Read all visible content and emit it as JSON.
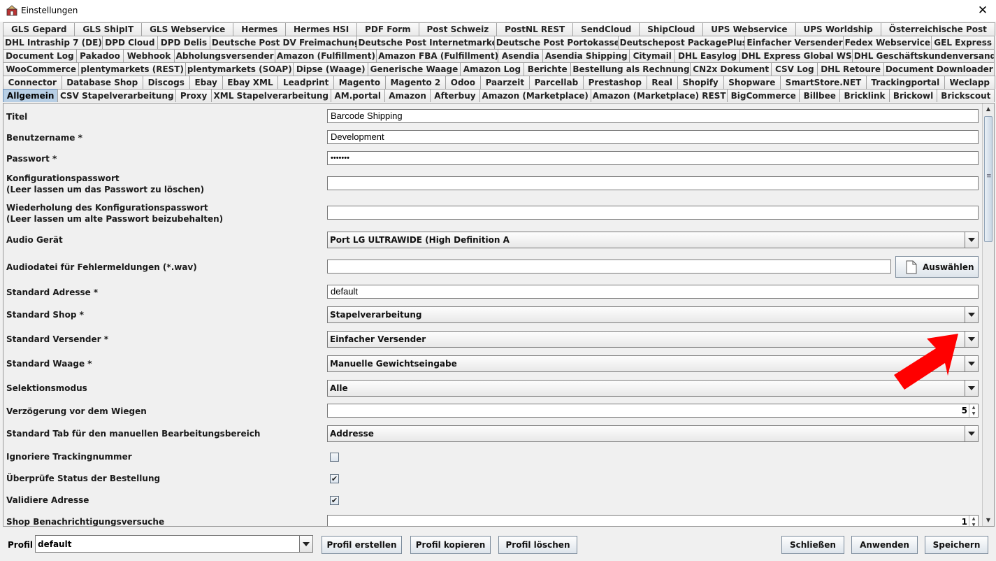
{
  "window": {
    "title": "Einstellungen",
    "close_glyph": "✕",
    "icon": "app-icon"
  },
  "tabs": {
    "row1": [
      "GLS Gepard",
      "GLS ShipIT",
      "GLS Webservice",
      "Hermes",
      "Hermes HSI",
      "PDF Form",
      "Post Schweiz",
      "PostNL REST",
      "SendCloud",
      "ShipCloud",
      "UPS Webservice",
      "UPS Worldship",
      "Österreichische Post"
    ],
    "row2": [
      "DHL Intraship 7 (DE)",
      "DPD Cloud",
      "DPD Delis",
      "Deutsche Post DV Freimachung",
      "Deutsche Post Internetmarke",
      "Deutsche Post Portokasse",
      "Deutschepost PackagePlus",
      "Einfacher Versender",
      "Fedex Webservice",
      "GEL Express"
    ],
    "row3": [
      "Document Log",
      "Pakadoo",
      "Webhook",
      "Abholungsversender",
      "Amazon (Fulfillment)",
      "Amazon FBA (Fulfillment)",
      "Asendia",
      "Asendia Shipping",
      "Citymail",
      "DHL Easylog",
      "DHL Express Global WS",
      "DHL Geschäftskundenversand"
    ],
    "row4": [
      "WooCommerce",
      "plentymarkets (REST)",
      "plentymarkets (SOAP)",
      "Dipse (Waage)",
      "Generische Waage",
      "Amazon Log",
      "Berichte",
      "Bestellung als Rechnung",
      "CN2x Dokument",
      "CSV Log",
      "DHL Retoure",
      "Document Downloader"
    ],
    "row5": [
      "Connector",
      "Database Shop",
      "Discogs",
      "Ebay",
      "Ebay XML",
      "Leadprint",
      "Magento",
      "Magento 2",
      "Odoo",
      "Paarzeit",
      "Parcellab",
      "Prestashop",
      "Real",
      "Shopify",
      "Shopware",
      "SmartStore.NET",
      "Trackingportal",
      "Weclapp"
    ],
    "row6": [
      "Allgemein",
      "CSV Stapelverarbeitung",
      "Proxy",
      "XML Stapelverarbeitung",
      "AM.portal",
      "Amazon",
      "Afterbuy",
      "Amazon (Marketplace)",
      "Amazon (Marketplace) REST",
      "BigCommerce",
      "Billbee",
      "Bricklink",
      "Brickowl",
      "Brickscout"
    ],
    "active": "Allgemein"
  },
  "form": {
    "titel": {
      "label": "Titel",
      "value": "Barcode Shipping"
    },
    "benutzername": {
      "label": "Benutzername *",
      "value": "Development"
    },
    "passwort": {
      "label": "Passwort *",
      "value": "•••••••"
    },
    "konfig_pw": {
      "label": "Konfigurationspasswort",
      "hint": "(Leer lassen um das Passwort zu löschen)",
      "value": ""
    },
    "konfig_pw_repeat": {
      "label": "Wiederholung des Konfigurationspasswort",
      "hint": "(Leer lassen um alte Passwort beizubehalten)",
      "value": ""
    },
    "audio_geraet": {
      "label": "Audio Gerät",
      "value": "Port LG ULTRAWIDE (High Definition A"
    },
    "audiodatei": {
      "label": "Audiodatei für Fehlermeldungen (*.wav)",
      "value": "",
      "button": "Auswählen"
    },
    "standard_adresse": {
      "label": "Standard Adresse *",
      "value": "default"
    },
    "standard_shop": {
      "label": "Standard Shop *",
      "value": "Stapelverarbeitung"
    },
    "standard_versender": {
      "label": "Standard Versender *",
      "value": "Einfacher Versender"
    },
    "standard_waage": {
      "label": "Standard Waage *",
      "value": "Manuelle Gewichtseingabe"
    },
    "selektionsmodus": {
      "label": "Selektionsmodus",
      "value": "Alle"
    },
    "verzoegerung": {
      "label": "Verzögerung vor dem Wiegen",
      "value": "5"
    },
    "standard_tab": {
      "label": "Standard Tab für den manuellen Bearbeitungsbereich",
      "value": "Addresse"
    },
    "ignoriere_tracking": {
      "label": "Ignoriere Trackingnummer",
      "checked": ""
    },
    "pruefe_status": {
      "label": "Überprüfe Status der Bestellung",
      "checked": "✔"
    },
    "validiere_adresse": {
      "label": "Validiere Adresse",
      "checked": "✔"
    },
    "shop_benachrichtigung": {
      "label": "Shop Benachrichtigungsversuche",
      "value": "1"
    }
  },
  "annotation": {
    "arrow_color": "#ff0000",
    "arrow_icon": "red-pointer-arrow"
  },
  "footer": {
    "profil_label": "Profil",
    "profil_value": "default",
    "buttons": {
      "erstellen": "Profil erstellen",
      "kopieren": "Profil kopieren",
      "loeschen": "Profil löschen",
      "schliessen": "Schließen",
      "anwenden": "Anwenden",
      "speichern": "Speichern"
    }
  }
}
